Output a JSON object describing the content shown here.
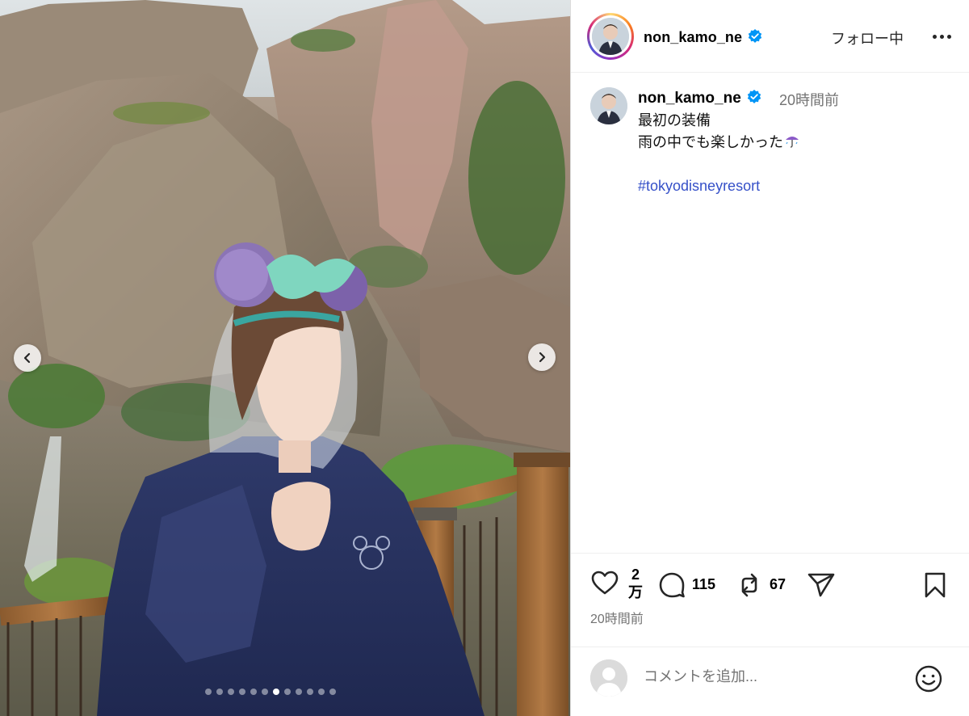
{
  "post": {
    "username": "non_kamo_ne",
    "follow_status": "フォロー中",
    "caption": {
      "time_ago": "20時間前",
      "lines": [
        "最初の装備",
        "雨の中でも楽しかった",
        "#tokyodisneyresort"
      ]
    },
    "actions": {
      "like_count_top": "2",
      "like_count_bottom": "万",
      "comment_count": "115",
      "repost_count": "67"
    },
    "timestamp": "20時間前",
    "comment_placeholder": "コメントを追加...",
    "carousel": {
      "total_slides": 12,
      "current_slide": 7
    }
  },
  "icons": {
    "verified": "verified-badge-icon",
    "like": "heart-icon",
    "comment": "speech-bubble-icon",
    "repost": "repost-icon",
    "share": "paper-plane-icon",
    "save": "bookmark-icon",
    "emoji": "smiley-icon",
    "more": "more-dots-icon"
  },
  "colors": {
    "verified": "#0095f6",
    "hashtag": "#3550c8",
    "secondary_text": "#737373"
  }
}
